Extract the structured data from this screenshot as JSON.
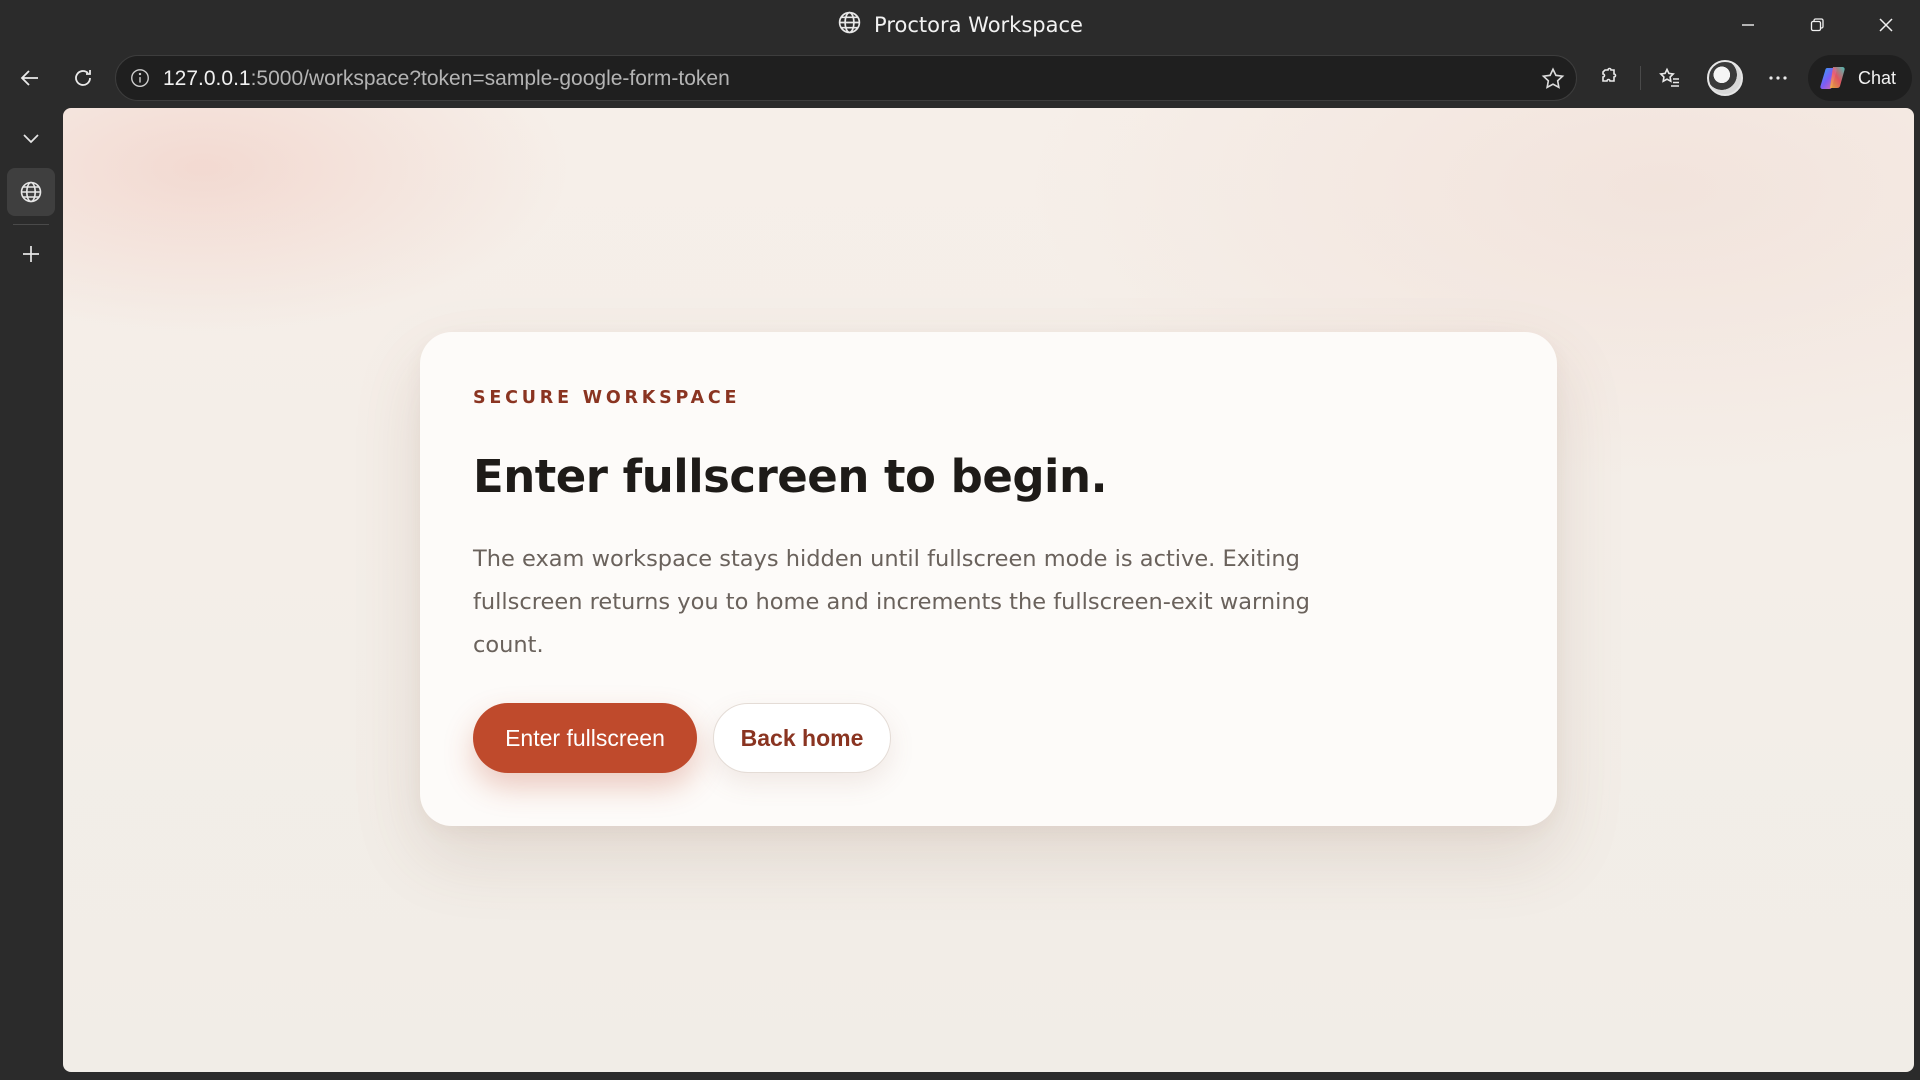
{
  "window": {
    "title": "Proctora Workspace"
  },
  "toolbar": {
    "url_host": "127.0.0.1",
    "url_rest": ":5000/workspace?token=sample-google-form-token",
    "chat_label": "Chat",
    "icons": {
      "back": "arrow-left-icon",
      "refresh": "refresh-icon",
      "info": "info-icon",
      "favorite": "star-icon",
      "extensions": "puzzle-icon",
      "favorites": "favorites-list-icon",
      "profile": "avatar",
      "more": "ellipsis-icon",
      "copilot": "copilot-logo-icon"
    }
  },
  "rail": {
    "icons": [
      "chevron-down-icon",
      "globe-icon",
      "plus-icon"
    ]
  },
  "page": {
    "eyebrow": "SECURE WORKSPACE",
    "heading": "Enter fullscreen to begin.",
    "description": "The exam workspace stays hidden until fullscreen mode is active. Exiting fullscreen returns you to home and increments the fullscreen-exit warning count.",
    "primary_button": "Enter fullscreen",
    "secondary_button": "Back home"
  },
  "colors": {
    "chrome": "#2b2b2b",
    "accent": "#bf4a2c",
    "accent_dark": "#8a3421",
    "card": "#fdfbf9",
    "heading": "#1e1b18",
    "body_text": "#6a625c"
  }
}
